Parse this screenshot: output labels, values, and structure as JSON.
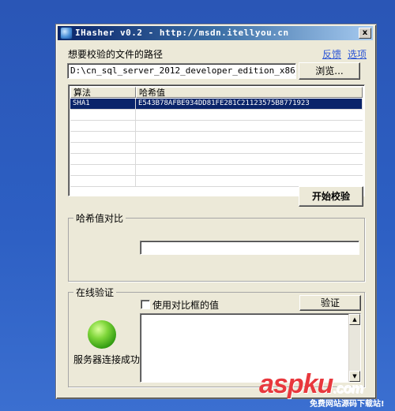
{
  "window": {
    "title": "IHasher v0.2 - http://msdn.itellyou.cn",
    "close_label": "x"
  },
  "file": {
    "prompt_label": "想要校验的文件的路径",
    "path_value": "D:\\cn_sql_server_2012_developer_edition_x86_x6",
    "browse_label": "浏览..."
  },
  "links": {
    "feedback": "反馈",
    "options": "选项"
  },
  "grid": {
    "columns": [
      "算法",
      "哈希值"
    ],
    "rows": [
      {
        "algorithm": "SHA1",
        "hash": "E543B78AFBE934DD81FE281C21123575B8771923",
        "selected": true
      }
    ]
  },
  "actions": {
    "start_verify_label": "开始校验"
  },
  "compare": {
    "group_label": "哈希值对比",
    "input_value": ""
  },
  "online": {
    "group_label": "在线验证",
    "use_compare_label": "使用对比框的值",
    "use_compare_checked": false,
    "verify_label": "验证",
    "status_text": "服务器连接成功",
    "status_color": "#4cbf1c"
  },
  "watermark": {
    "brand": "aspku",
    "domain_suffix": ".com",
    "tagline": "免费网站源码下载站!"
  }
}
